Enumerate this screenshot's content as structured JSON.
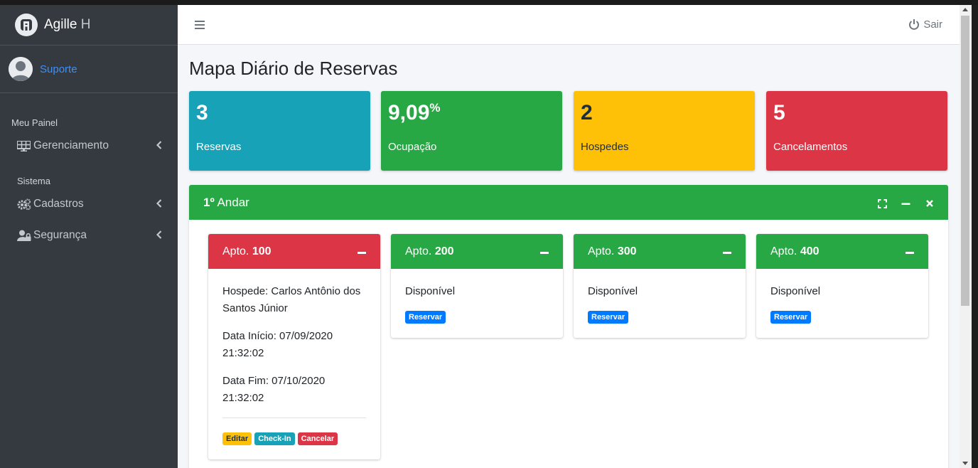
{
  "brand": {
    "name": "Agille",
    "suffix": "H"
  },
  "user": {
    "name": "Suporte"
  },
  "sidebar": {
    "sections": [
      {
        "header": "Meu Painel",
        "items": [
          {
            "label": "Gerenciamento",
            "icon": "dashboard-grid-icon"
          }
        ]
      },
      {
        "header": "Sistema",
        "items": [
          {
            "label": "Cadastros",
            "icon": "cogs-icon"
          },
          {
            "label": "Segurança",
            "icon": "user-lock-icon"
          }
        ]
      }
    ]
  },
  "navbar": {
    "logout_label": "Sair"
  },
  "page": {
    "title": "Mapa Diário de Reservas"
  },
  "stats": [
    {
      "value": "3",
      "suffix": "",
      "label": "Reservas",
      "color": "#17a2b8"
    },
    {
      "value": "9,09",
      "suffix": "%",
      "label": "Ocupação",
      "color": "#28a745"
    },
    {
      "value": "2",
      "suffix": "",
      "label": "Hospedes",
      "color": "#ffc107"
    },
    {
      "value": "5",
      "suffix": "",
      "label": "Cancelamentos",
      "color": "#dc3545"
    }
  ],
  "floor": {
    "number": "1º",
    "label": "Andar"
  },
  "apartments": [
    {
      "prefix": "Apto.",
      "number": "100",
      "status": "occupied",
      "guest": "Hospede: Carlos Antônio dos Santos Júnior",
      "start": "Data Início: 07/09/2020 21:32:02",
      "end": "Data Fim: 07/10/2020 21:32:02",
      "actions": {
        "edit": "Editar",
        "checkin": "Check-In",
        "cancel": "Cancelar"
      }
    },
    {
      "prefix": "Apto.",
      "number": "200",
      "status_text": "Disponível",
      "action": "Reservar"
    },
    {
      "prefix": "Apto.",
      "number": "300",
      "status_text": "Disponível",
      "action": "Reservar"
    },
    {
      "prefix": "Apto.",
      "number": "400",
      "status_text": "Disponível",
      "action": "Reservar"
    }
  ]
}
